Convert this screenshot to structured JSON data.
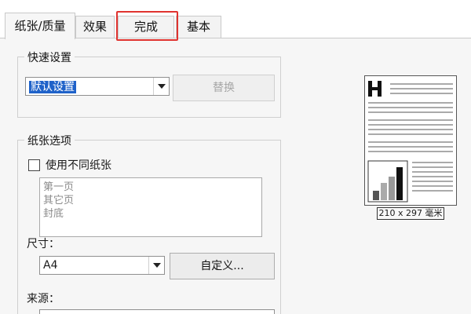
{
  "tabs": [
    {
      "label": "纸张/质量",
      "active": true
    },
    {
      "label": "效果",
      "active": false
    },
    {
      "label": "完成",
      "active": false,
      "highlighted": true
    },
    {
      "label": "基本",
      "active": false
    }
  ],
  "quick_settings": {
    "title": "快速设置",
    "selected": "默认设置",
    "replace_button": "替换"
  },
  "paper_options": {
    "title": "纸张选项",
    "different_paper_label": "使用不同纸张",
    "different_paper_checked": false,
    "page_list": [
      "第一页",
      "其它页",
      "封底"
    ],
    "size_label": "尺寸：",
    "size_value": "A4",
    "custom_button": "自定义...",
    "source_label": "来源："
  },
  "preview": {
    "size_text": "210 x 297 毫米"
  },
  "colors": {
    "highlight": "#e0332f",
    "selection": "#1f62c9"
  }
}
